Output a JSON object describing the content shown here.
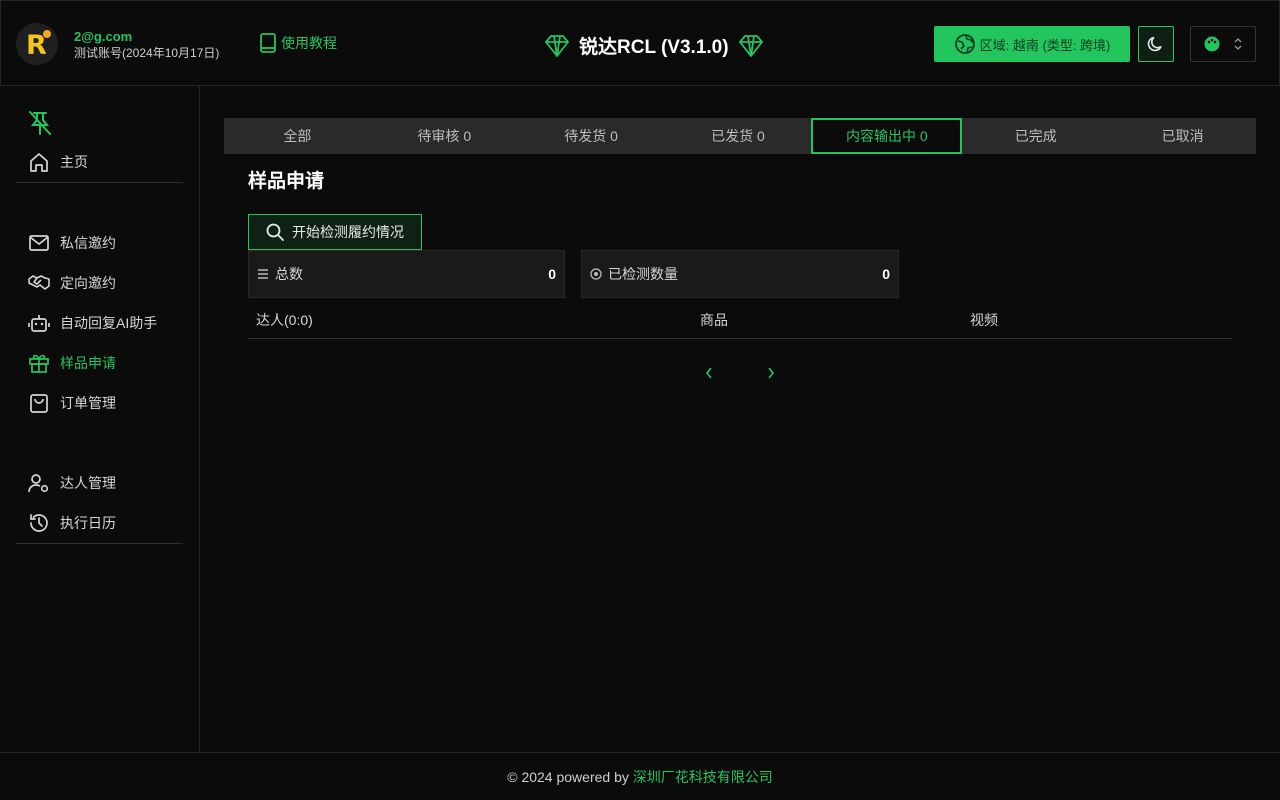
{
  "header": {
    "user_email": "2@g.com",
    "account_label": "测试账号(2024年10月17日)",
    "tutorial_label": "使用教程",
    "app_title": "锐达RCL (V3.1.0)",
    "region_label": "区域: 越南 (类型: 跨境)",
    "logo_letter": "R"
  },
  "sidebar": {
    "items": [
      {
        "label": "主页",
        "icon": "home-icon"
      },
      {
        "label": "私信邀约",
        "icon": "mail-icon"
      },
      {
        "label": "定向邀约",
        "icon": "handshake-icon"
      },
      {
        "label": "自动回复AI助手",
        "icon": "robot-icon"
      },
      {
        "label": "样品申请",
        "icon": "gift-icon",
        "active": true
      },
      {
        "label": "订单管理",
        "icon": "shopping-bag-icon"
      },
      {
        "label": "达人管理",
        "icon": "user-gear-icon"
      },
      {
        "label": "执行日历",
        "icon": "history-icon"
      }
    ]
  },
  "tabs": [
    {
      "label": "全部"
    },
    {
      "label": "待审核 0"
    },
    {
      "label": "待发货 0"
    },
    {
      "label": "已发货 0"
    },
    {
      "label": "内容输出中 0",
      "active": true
    },
    {
      "label": "已完成"
    },
    {
      "label": "已取消"
    }
  ],
  "main": {
    "title": "样品申请",
    "check_button": "开始检测履约情况",
    "stats": [
      {
        "label": "总数",
        "value": "0"
      },
      {
        "label": "已检测数量",
        "value": "0"
      }
    ],
    "columns": [
      "达人(0:0)",
      "商品",
      "视频"
    ]
  },
  "footer": {
    "prefix": "© 2024 powered by ",
    "company": "深圳厂花科技有限公司"
  },
  "colors": {
    "accent": "#22c55e",
    "background": "#0b0b0b",
    "tab_bar": "#2a2a2a"
  }
}
